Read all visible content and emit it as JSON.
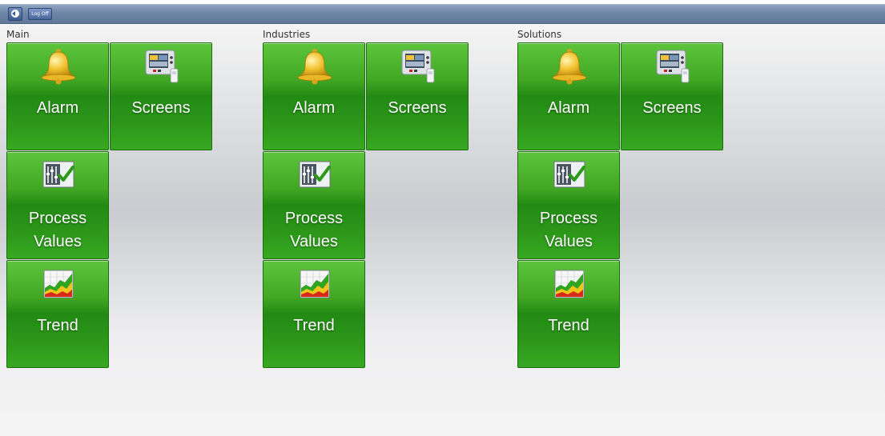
{
  "toolbar": {
    "back_icon": "back-arrow-icon",
    "logoff_label": "Log Off"
  },
  "groups": [
    {
      "title": "Main",
      "tiles": [
        {
          "label": "Alarm",
          "icon": "bell-icon"
        },
        {
          "label": "Screens",
          "icon": "hmi-panel-icon"
        },
        {
          "label": "Process\nValues",
          "icon": "process-values-icon"
        },
        {
          "label": "Trend",
          "icon": "trend-chart-icon"
        }
      ]
    },
    {
      "title": "Industries",
      "tiles": [
        {
          "label": "Alarm",
          "icon": "bell-icon"
        },
        {
          "label": "Screens",
          "icon": "hmi-panel-icon"
        },
        {
          "label": "Process\nValues",
          "icon": "process-values-icon"
        },
        {
          "label": "Trend",
          "icon": "trend-chart-icon"
        }
      ]
    },
    {
      "title": "Solutions",
      "tiles": [
        {
          "label": "Alarm",
          "icon": "bell-icon"
        },
        {
          "label": "Screens",
          "icon": "hmi-panel-icon"
        },
        {
          "label": "Process\nValues",
          "icon": "process-values-icon"
        },
        {
          "label": "Trend",
          "icon": "trend-chart-icon"
        }
      ]
    }
  ],
  "colors": {
    "tile_green": "#3aa31f",
    "toolbar_blue": "#6e86a6"
  }
}
